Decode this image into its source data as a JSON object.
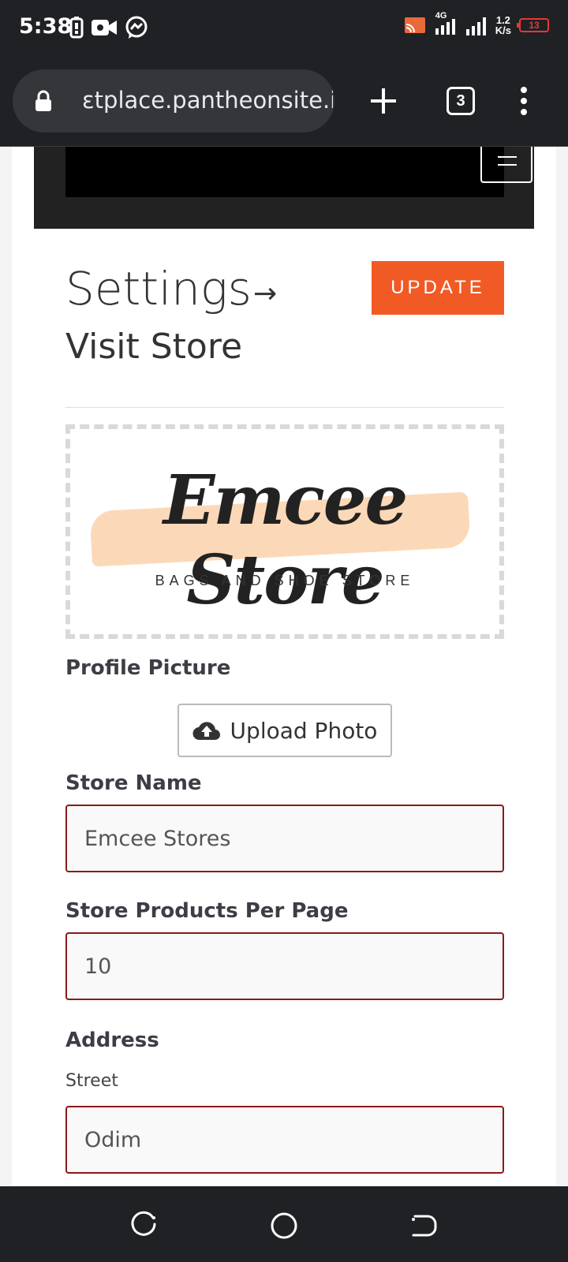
{
  "status_bar": {
    "time": "5:38",
    "network": "4G",
    "speed_top": "1.2",
    "speed_bottom": "K/s",
    "battery": "13"
  },
  "browser": {
    "url": "ɛtplace.pantheonsite.io",
    "tab_count": "3"
  },
  "page": {
    "title": "Settings",
    "arrow": "→",
    "visit_store": "Visit Store",
    "update_label": "UPDATE",
    "logo": {
      "name": "Emcee Store",
      "tagline": "BAGS AND SHOE STORE"
    },
    "profile_picture_label": "Profile Picture",
    "upload_label": "Upload Photo",
    "store_name_label": "Store Name",
    "store_name_value": "Emcee Stores",
    "products_per_page_label": "Store Products Per Page",
    "products_per_page_value": "10",
    "address_label": "Address",
    "street_label": "Street",
    "street_value": "Odim"
  },
  "colors": {
    "accent": "#f15a24",
    "field_border": "#8b1a1a",
    "chrome_bg": "#202124"
  }
}
